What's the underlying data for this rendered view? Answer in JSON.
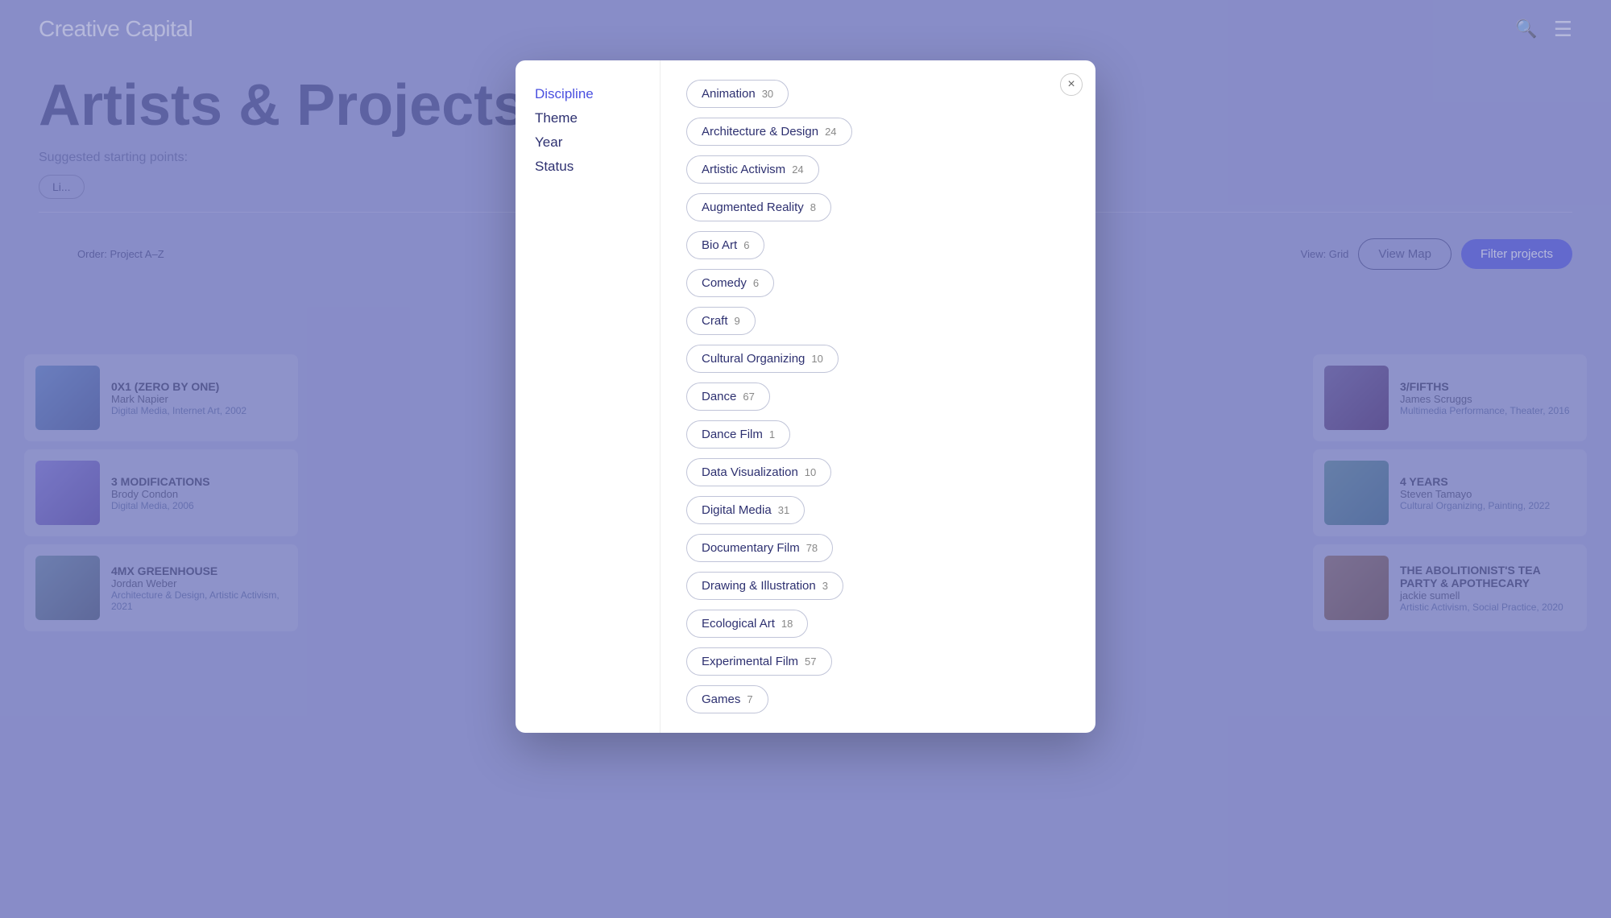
{
  "site": {
    "logo": "Creative Capital",
    "title": "Artists & Projects"
  },
  "header": {
    "search_icon": "🔍",
    "menu_icon": "≡"
  },
  "page": {
    "title": "Artists & Proje",
    "suggested_label": "Suggested starting points:",
    "suggested_tag": "Li..."
  },
  "toolbar": {
    "order_label": "Order: Project A–Z",
    "view_label": "View: Grid",
    "view_map_btn": "View Map",
    "filter_btn": "Filter projects"
  },
  "modal": {
    "close_icon": "×",
    "filters": [
      {
        "id": "discipline",
        "label": "Discipline",
        "active": true
      },
      {
        "id": "theme",
        "label": "Theme",
        "active": false
      },
      {
        "id": "year",
        "label": "Year",
        "active": false
      },
      {
        "id": "status",
        "label": "Status",
        "active": false
      }
    ],
    "disciplines": [
      {
        "name": "Animation",
        "count": 30
      },
      {
        "name": "Architecture & Design",
        "count": 24
      },
      {
        "name": "Artistic Activism",
        "count": 24
      },
      {
        "name": "Augmented Reality",
        "count": 8
      },
      {
        "name": "Bio Art",
        "count": 6
      },
      {
        "name": "Comedy",
        "count": 6
      },
      {
        "name": "Craft",
        "count": 9
      },
      {
        "name": "Cultural Organizing",
        "count": 10
      },
      {
        "name": "Dance",
        "count": 67
      },
      {
        "name": "Dance Film",
        "count": 1
      },
      {
        "name": "Data Visualization",
        "count": 10
      },
      {
        "name": "Digital Media",
        "count": 31
      },
      {
        "name": "Documentary Film",
        "count": 78
      },
      {
        "name": "Drawing & Illustration",
        "count": 3
      },
      {
        "name": "Ecological Art",
        "count": 18
      },
      {
        "name": "Experimental Film",
        "count": 57
      },
      {
        "name": "Games",
        "count": 7
      }
    ]
  },
  "left_projects": [
    {
      "title": "0X1 (ZERO BY ONE)",
      "artist": "Mark Napier",
      "meta": "Digital Media, Internet Art, 2002",
      "thumb_class": "thumb-blue"
    },
    {
      "title": "3 MODIFICATIONS",
      "artist": "Brody Condon",
      "meta": "Digital Media, 2006",
      "thumb_class": "thumb-purple"
    },
    {
      "title": "4MX GREENHOUSE",
      "artist": "Jordan Weber",
      "meta": "Architecture & Design, Artistic Activism, 2021",
      "thumb_class": "thumb-green"
    }
  ],
  "right_projects": [
    {
      "title": "3/FIFTHS",
      "artist": "James Scruggs",
      "meta": "Multimedia Performance, Theater, 2016",
      "thumb_class": "thumb-right1"
    },
    {
      "title": "4 YEARS",
      "artist": "Steven Tamayo",
      "meta": "Cultural Organizing, Painting, 2022",
      "thumb_class": "thumb-right2"
    },
    {
      "title": "THE ABOLITIONIST'S TEA PARTY & APOTHECARY",
      "artist": "jackie sumell",
      "meta": "Artistic Activism, Social Practice, 2020",
      "thumb_class": "thumb-right3"
    }
  ]
}
